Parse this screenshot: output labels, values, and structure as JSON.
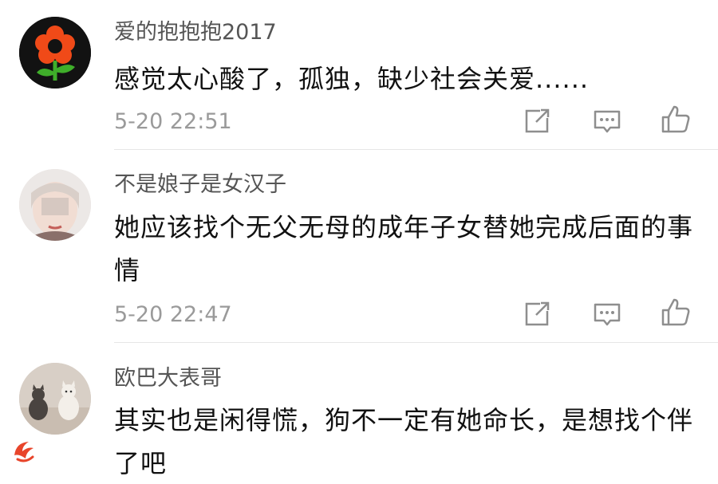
{
  "comments": [
    {
      "username": "爱的抱抱抱2017",
      "text": "感觉太心酸了，孤独，缺少社会关爱......",
      "time": "5-20 22:51"
    },
    {
      "username": "不是娘子是女汉子",
      "text": "她应该找个无父无母的成年子女替她完成后面的事情",
      "time": "5-20 22:47"
    },
    {
      "username": "欧巴大表哥",
      "text": "其实也是闲得慌，狗不一定有她命长，是想找个伴了吧",
      "time": ""
    }
  ],
  "icons": {
    "share": "share-icon",
    "reply": "comment-icon",
    "like": "thumbs-up-icon"
  },
  "colors": {
    "username": "#555555",
    "meta": "#9a9a9a",
    "divider": "#e6e6e6",
    "watermark": "#e8452b"
  }
}
